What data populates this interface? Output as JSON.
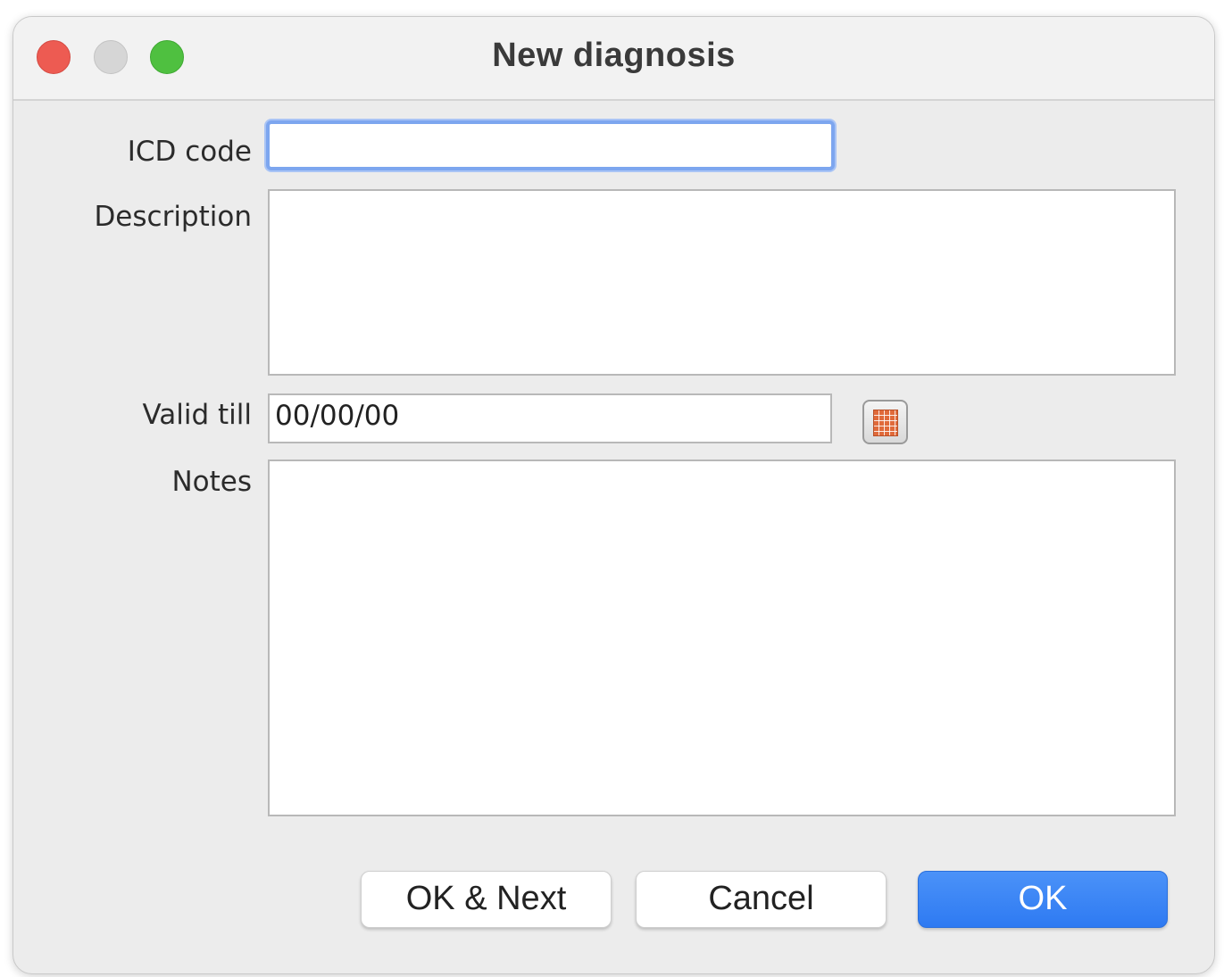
{
  "window": {
    "title": "New diagnosis"
  },
  "form": {
    "icd_code": {
      "label": "ICD code",
      "value": ""
    },
    "description": {
      "label": "Description",
      "value": ""
    },
    "valid_till": {
      "label": "Valid till",
      "value": "00/00/00"
    },
    "notes": {
      "label": "Notes",
      "value": ""
    }
  },
  "buttons": {
    "ok_next": "OK & Next",
    "cancel": "Cancel",
    "ok": "OK"
  },
  "icons": {
    "close": "close-icon",
    "minimize": "minimize-icon",
    "maximize": "maximize-icon",
    "calendar": "calendar-icon"
  },
  "colors": {
    "accent": "#2e7af2",
    "focus_ring": "#7da6ef",
    "close": "#ed5b52",
    "maximize": "#4fc040",
    "calendar": "#e06a3a"
  }
}
